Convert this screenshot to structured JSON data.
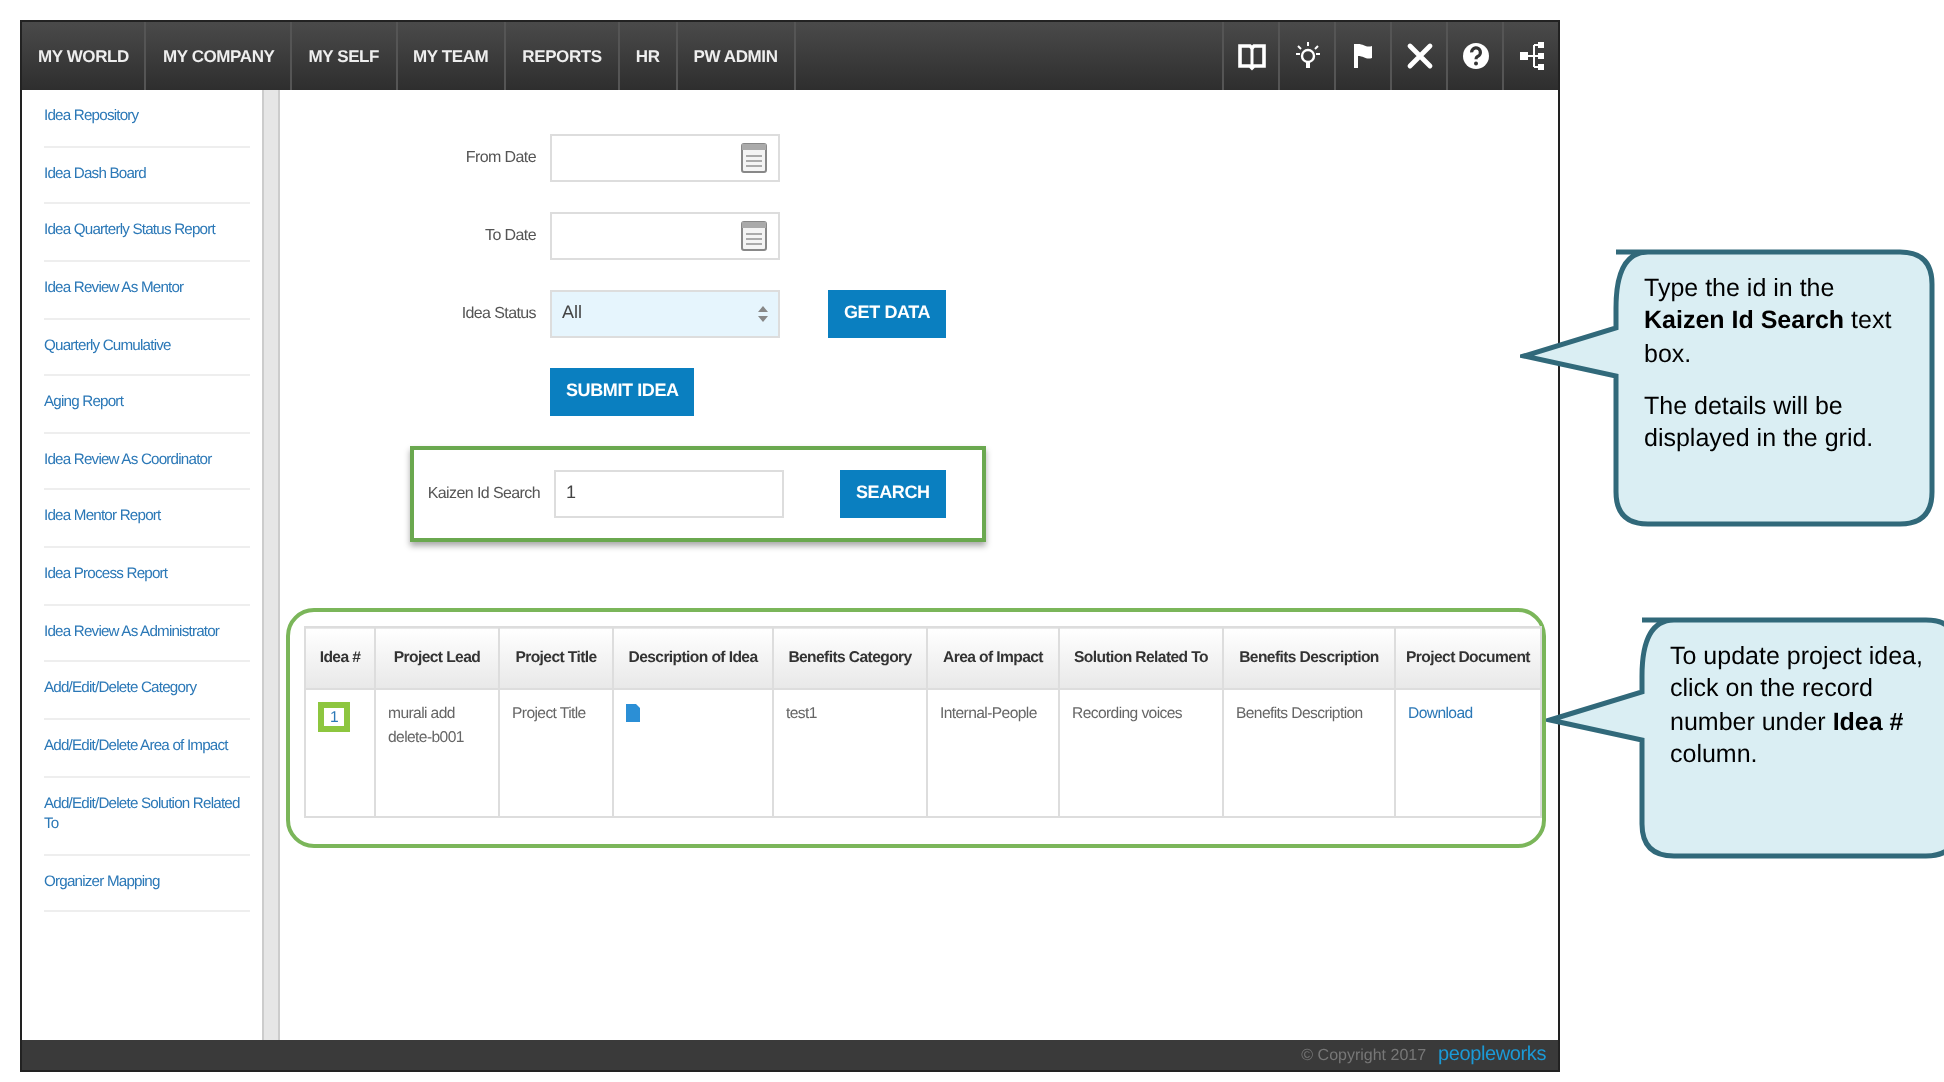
{
  "nav": {
    "items": [
      "MY WORLD",
      "MY COMPANY",
      "MY SELF",
      "MY TEAM",
      "REPORTS",
      "HR",
      "PW ADMIN"
    ]
  },
  "sidebar": {
    "items": [
      {
        "label": "Idea Repository"
      },
      {
        "label": "Idea Dash Board"
      },
      {
        "label": "Idea Quarterly Status Report"
      },
      {
        "label": "Idea Review As Mentor"
      },
      {
        "label": "Quarterly Cumulative"
      },
      {
        "label": "Aging Report"
      },
      {
        "label": "Idea Review As Coordinator"
      },
      {
        "label": "Idea Mentor Report"
      },
      {
        "label": "Idea Process Report"
      },
      {
        "label": "Idea Review As Administrator"
      },
      {
        "label": "Add/Edit/Delete Category"
      },
      {
        "label": "Add/Edit/Delete Area of Impact"
      },
      {
        "label": "Add/Edit/Delete Solution Related To"
      },
      {
        "label": "Organizer Mapping"
      }
    ]
  },
  "form": {
    "fields": [
      {
        "kind": "date",
        "label": "From Date"
      },
      {
        "kind": "date",
        "label": "To Date"
      },
      {
        "kind": "select",
        "label": "Idea Status",
        "value": "All",
        "button": "GET DATA"
      }
    ],
    "submit_button": "SUBMIT IDEA",
    "search": {
      "label": "Kaizen Id Search",
      "value": "1",
      "button": "SEARCH",
      "highlighted": true
    }
  },
  "table": {
    "highlighted": true,
    "columns": [
      "Idea #",
      "Project Lead",
      "Project Title",
      "Description of Idea",
      "Benefits Category",
      "Area of Impact",
      "Solution Related To",
      "Benefits Description",
      "Project Document"
    ],
    "rows": [
      {
        "cells": [
          {
            "kind": "link",
            "text": "1",
            "highlighted": true
          },
          {
            "kind": "text",
            "text": "murali add delete-b001"
          },
          {
            "kind": "text",
            "text": "Project Title"
          },
          {
            "kind": "icon"
          },
          {
            "kind": "text",
            "text": "test1"
          },
          {
            "kind": "text",
            "text": "Internal-People"
          },
          {
            "kind": "text",
            "text": "Recording voices"
          },
          {
            "kind": "text",
            "text": "Benefits Description"
          },
          {
            "kind": "link",
            "text": "Download"
          }
        ]
      }
    ]
  },
  "footer": {
    "copyright": "© Copyright 2017",
    "logo": "peopleworks"
  },
  "callouts": [
    {
      "paragraphs": [
        "Type the id in the **Kaizen Id Search** text box.",
        "The details will be displayed in the grid."
      ]
    },
    {
      "paragraphs": [
        "To update project idea, click on the record number under **Idea #** column."
      ]
    }
  ]
}
